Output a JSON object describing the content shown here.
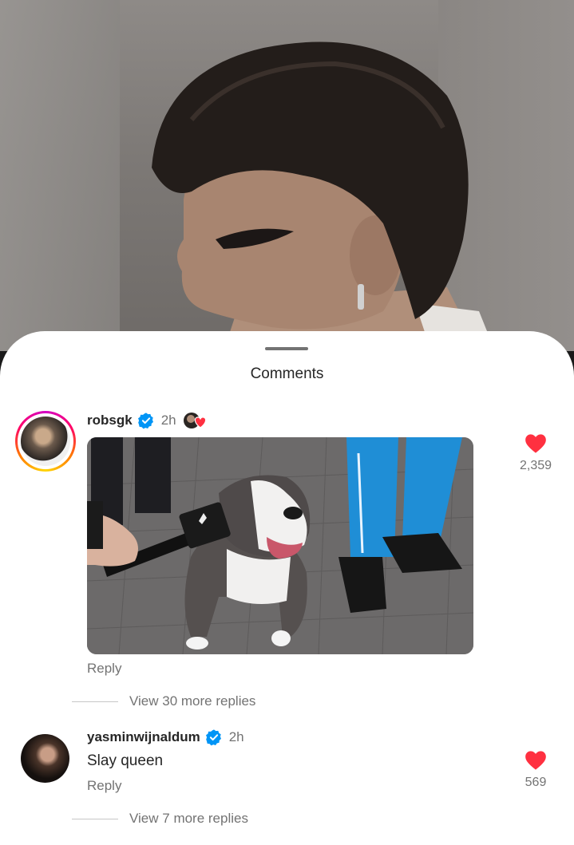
{
  "sheet": {
    "title": "Comments"
  },
  "comments": [
    {
      "username": "robsgk",
      "time": "2h",
      "attachment": "gif",
      "reply_label": "Reply",
      "likes": "2,359",
      "view_replies": "View 30 more replies"
    },
    {
      "username": "yasminwijnaldum",
      "time": "2h",
      "text": "Slay queen",
      "reply_label": "Reply",
      "likes": "569",
      "view_replies": "View 7 more replies"
    }
  ],
  "colors": {
    "heart": "#ff3040",
    "verified": "#0095f6",
    "secondary_text": "#737373"
  },
  "icons": [
    "verified-badge-icon",
    "heart-icon",
    "liked-by-creator-icon"
  ]
}
